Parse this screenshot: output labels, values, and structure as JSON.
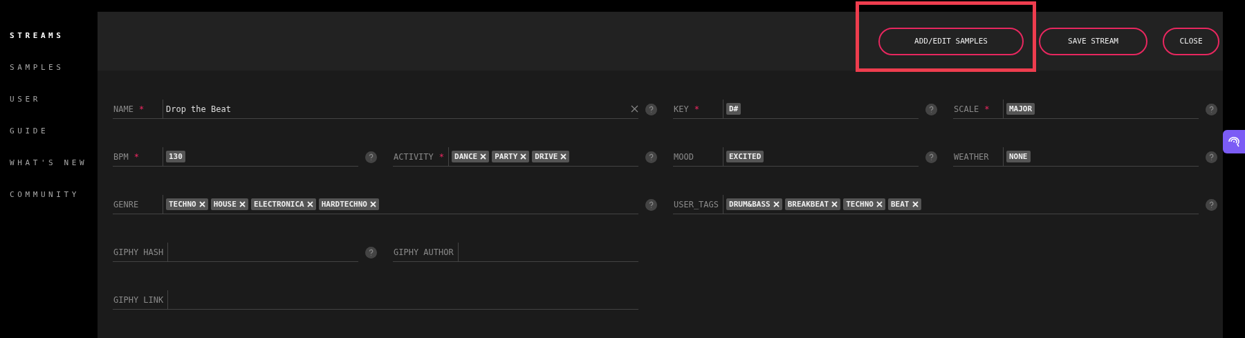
{
  "sidebar": {
    "items": [
      {
        "label": "STREAMS",
        "selected": true
      },
      {
        "label": "SAMPLES",
        "selected": false
      },
      {
        "label": "USER",
        "selected": false
      },
      {
        "label": "GUIDE",
        "selected": false
      },
      {
        "label": "WHAT'S NEW",
        "selected": false
      },
      {
        "label": "COMMUNITY",
        "selected": false
      }
    ]
  },
  "header": {
    "buttons": [
      {
        "label": "ADD/EDIT SAMPLES",
        "highlighted": true
      },
      {
        "label": "SAVE STREAM",
        "highlighted": false
      },
      {
        "label": "CLOSE",
        "highlighted": false
      }
    ]
  },
  "form": {
    "fields": [
      {
        "label": "NAME",
        "required_mark": "*",
        "kind": "text",
        "value": "Drop the Beat",
        "help": true
      },
      {
        "label": "KEY",
        "required_mark": "*",
        "kind": "chips",
        "values": [
          "D#"
        ],
        "help": true
      },
      {
        "label": "SCALE",
        "required_mark": "*",
        "kind": "chips",
        "values": [
          "MAJOR"
        ],
        "help": true
      },
      {
        "label": "BPM",
        "required_mark": "*",
        "kind": "chips",
        "values": [
          "130"
        ],
        "help": true
      },
      {
        "label": "ACTIVITY",
        "required_mark": "*",
        "kind": "tags",
        "values": [
          "DANCE",
          "PARTY",
          "DRIVE"
        ],
        "help": true
      },
      {
        "label": "MOOD",
        "kind": "chips",
        "values": [
          "EXCITED"
        ],
        "help": true
      },
      {
        "label": "WEATHER",
        "kind": "chips",
        "values": [
          "NONE"
        ],
        "help": true
      },
      {
        "label": "GENRE",
        "kind": "tags",
        "values": [
          "TECHNO",
          "HOUSE",
          "ELECTRONICA",
          "HARDTECHNO"
        ],
        "help": true
      },
      {
        "label": "USER_TAGS",
        "kind": "tags",
        "values": [
          "DRUM&BASS",
          "BREAKBEAT",
          "TECHNO",
          "BEAT"
        ],
        "help": true
      },
      {
        "label": "GIPHY HASH",
        "kind": "empty",
        "help": true
      },
      {
        "label": "GIPHY AUTHOR",
        "kind": "empty",
        "help": false
      },
      {
        "label": "GIPHY LINK",
        "kind": "empty",
        "help": false
      }
    ]
  }
}
